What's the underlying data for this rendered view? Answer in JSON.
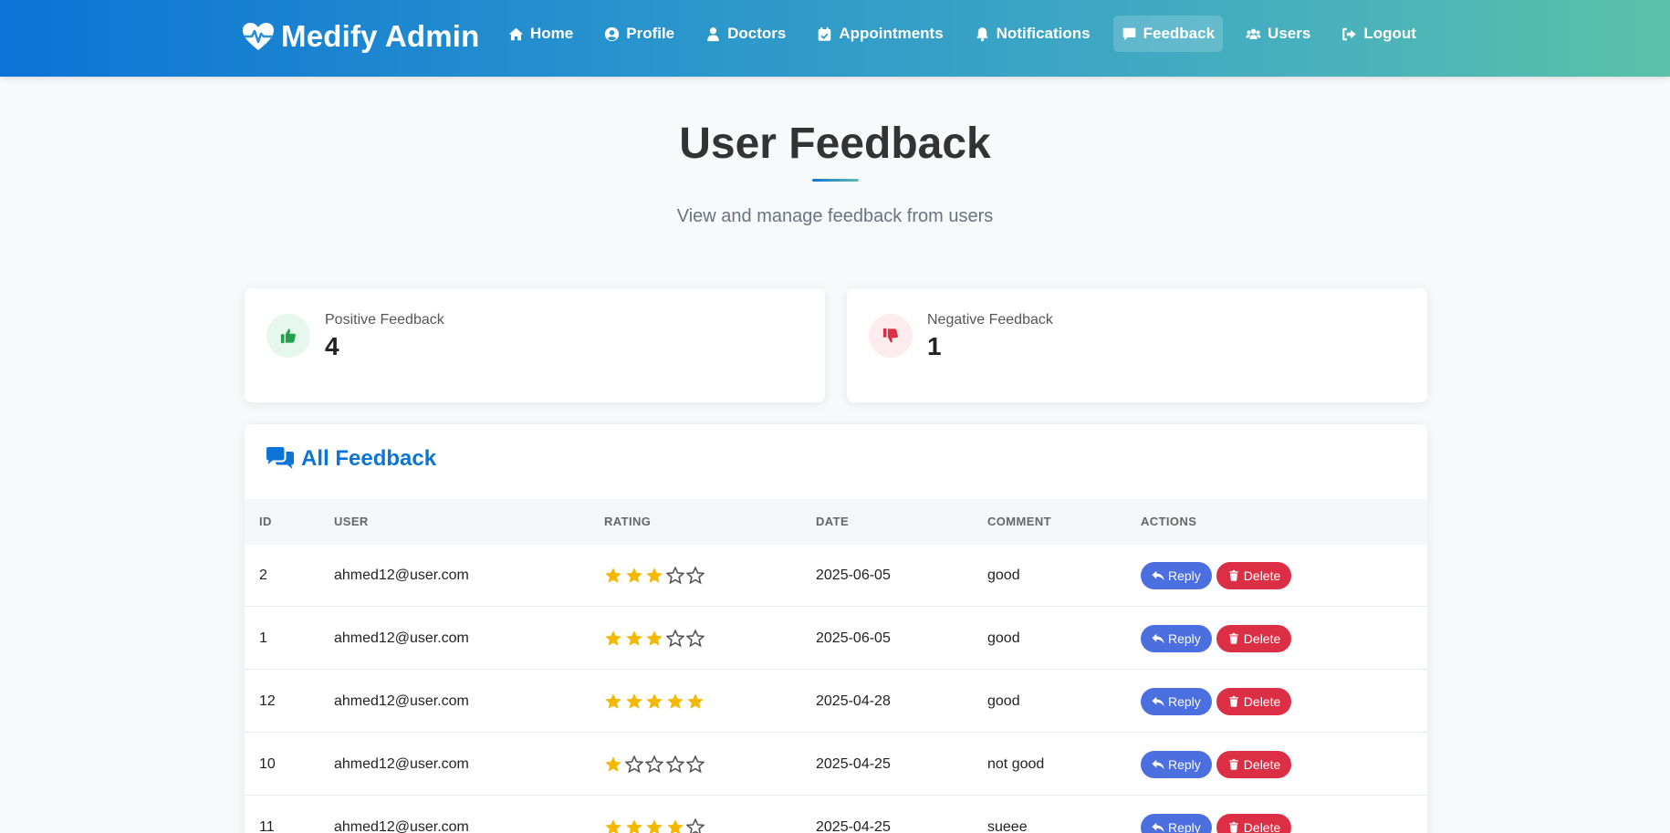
{
  "navbar": {
    "brand": "Medify Admin",
    "items": [
      {
        "label": "Home",
        "icon": "home-icon"
      },
      {
        "label": "Profile",
        "icon": "user-circle-icon"
      },
      {
        "label": "Doctors",
        "icon": "doctor-icon"
      },
      {
        "label": "Appointments",
        "icon": "calendar-icon"
      },
      {
        "label": "Notifications",
        "icon": "bell-icon"
      },
      {
        "label": "Feedback",
        "icon": "comment-icon",
        "active": true
      },
      {
        "label": "Users",
        "icon": "users-icon"
      },
      {
        "label": "Logout",
        "icon": "logout-icon"
      }
    ]
  },
  "header": {
    "title": "User Feedback",
    "subtitle": "View and manage feedback from users"
  },
  "stats": {
    "positive": {
      "label": "Positive Feedback",
      "value": "4"
    },
    "negative": {
      "label": "Negative Feedback",
      "value": "1"
    }
  },
  "table": {
    "title": "All Feedback",
    "columns": {
      "id": "ID",
      "user": "USER",
      "rating": "RATING",
      "date": "DATE",
      "comment": "COMMENT",
      "actions": "ACTIONS"
    },
    "reply_label": "Reply",
    "delete_label": "Delete",
    "rows": [
      {
        "id": "2",
        "user": "ahmed12@user.com",
        "rating": 3,
        "date": "2025-06-05",
        "comment": "good"
      },
      {
        "id": "1",
        "user": "ahmed12@user.com",
        "rating": 3,
        "date": "2025-06-05",
        "comment": "good"
      },
      {
        "id": "12",
        "user": "ahmed12@user.com",
        "rating": 5,
        "date": "2025-04-28",
        "comment": "good"
      },
      {
        "id": "10",
        "user": "ahmed12@user.com",
        "rating": 1,
        "date": "2025-04-25",
        "comment": "not good"
      },
      {
        "id": "11",
        "user": "ahmed12@user.com",
        "rating": 4,
        "date": "2025-04-25",
        "comment": "sueee"
      }
    ]
  },
  "colors": {
    "accent": "#0b74d6",
    "star": "#f5b800",
    "reply": "#4c6fdf",
    "delete": "#dc2f45",
    "positive": "#22a04b",
    "negative": "#dc2f45"
  }
}
